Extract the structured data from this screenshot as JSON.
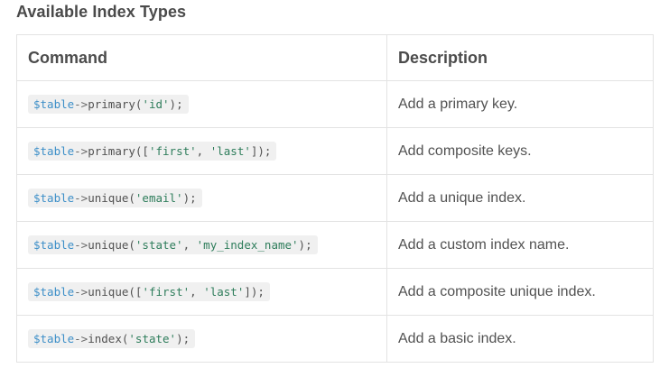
{
  "heading": "Available Index Types",
  "table": {
    "headers": [
      "Command",
      "Description"
    ],
    "rows": [
      {
        "command": {
          "var": "$table",
          "arrow": "->",
          "method": "primary",
          "args": "('id');"
        },
        "description": "Add a primary key."
      },
      {
        "command": {
          "var": "$table",
          "arrow": "->",
          "method": "primary",
          "args": "(['first', 'last']);"
        },
        "description": "Add composite keys."
      },
      {
        "command": {
          "var": "$table",
          "arrow": "->",
          "method": "unique",
          "args": "('email');"
        },
        "description": "Add a unique index."
      },
      {
        "command": {
          "var": "$table",
          "arrow": "->",
          "method": "unique",
          "args": "('state', 'my_index_name');"
        },
        "description": "Add a custom index name."
      },
      {
        "command": {
          "var": "$table",
          "arrow": "->",
          "method": "unique",
          "args": "(['first', 'last']);"
        },
        "description": "Add a composite unique index."
      },
      {
        "command": {
          "var": "$table",
          "arrow": "->",
          "method": "index",
          "args": "('state');"
        },
        "description": "Add a basic index."
      }
    ]
  },
  "colors": {
    "variable": "#3d8fc8",
    "string": "#2e7d5b",
    "code_bg": "#f0f0f0",
    "border": "#e3e3e3"
  }
}
